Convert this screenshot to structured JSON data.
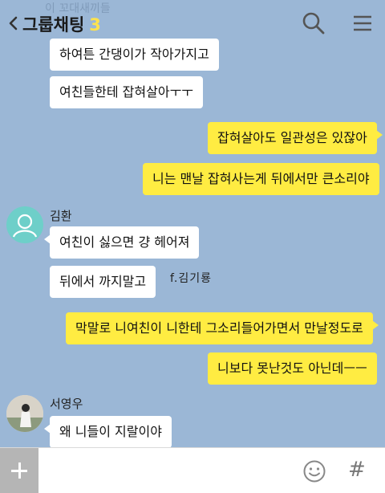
{
  "header": {
    "title": "그룹채팅",
    "member_count": "3",
    "faded_top_text": "이 꼬대새끼들"
  },
  "messages": [
    {
      "text": "하여튼 간댕이가 작아가지고"
    },
    {
      "text": "여친들한테 잡혀살아ㅜㅜ"
    },
    {
      "text": "잡혀살아도 일관성은 있잖아"
    },
    {
      "text": "니는 맨날 잡혀사는게 뒤에서만 큰소리야"
    },
    {
      "sender": "김환"
    },
    {
      "text": "여친이 싫으면 걍 헤어져"
    },
    {
      "text": "뒤에서 까지말고"
    },
    {
      "text": "막말로 니여친이 니한테 그소리들어가면서 만날정도로"
    },
    {
      "text": "니보다 못난것도 아닌데ㅡㅡ"
    },
    {
      "sender": "서영우"
    },
    {
      "text": "왜 니들이 지랄이야"
    }
  ],
  "watermark": "f.김기룡",
  "input": {
    "placeholder": ""
  },
  "icons": {
    "back": "chevron-left-icon",
    "search": "search-icon",
    "menu": "hamburger-menu-icon",
    "attach": "plus-icon",
    "emoticon": "smiley-icon",
    "hashtag": "hashtag-icon"
  },
  "colors": {
    "background": "#9bb7d6",
    "my_bubble": "#ffec42",
    "other_bubble": "#ffffff",
    "count_accent": "#ffe34d"
  }
}
